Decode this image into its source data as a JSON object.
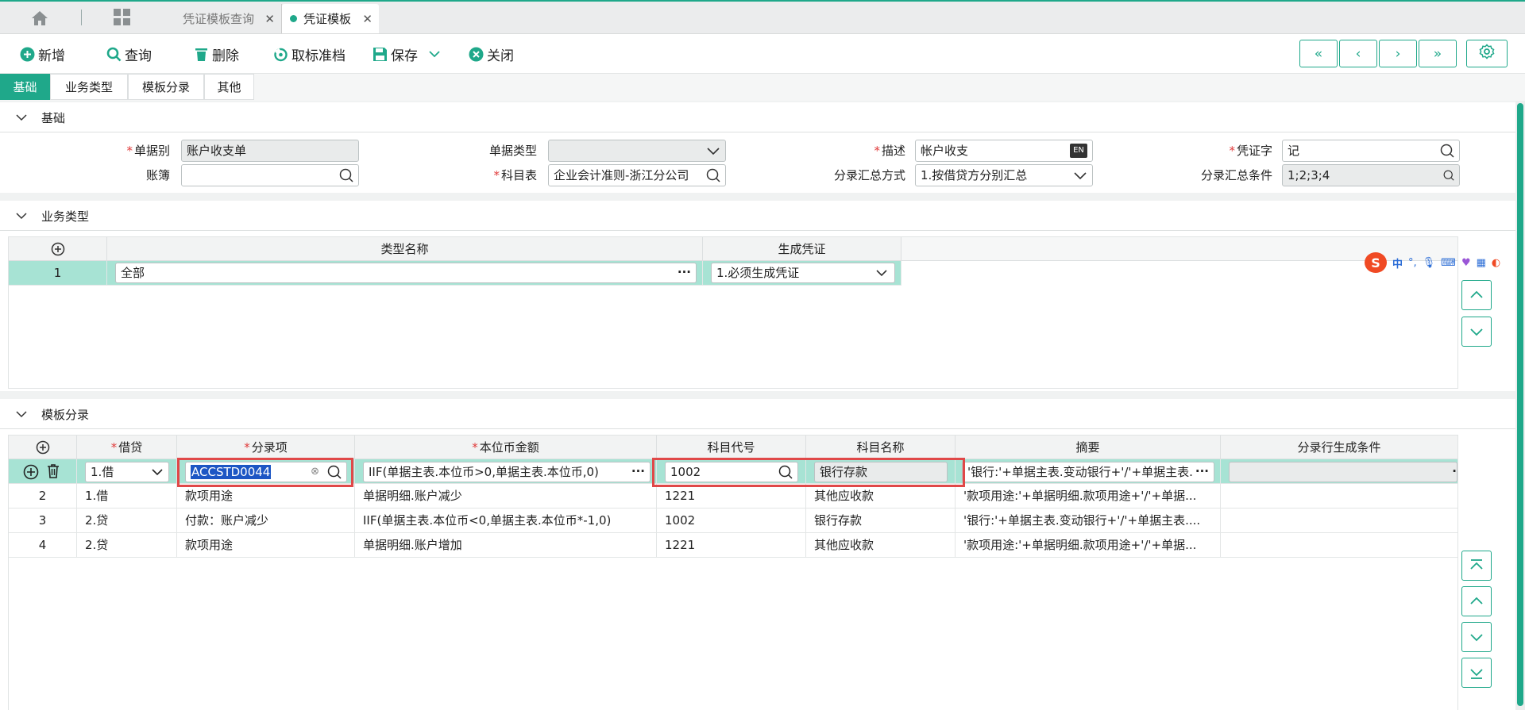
{
  "tabs": [
    {
      "label": "凭证模板查询"
    },
    {
      "label": "凭证模板"
    }
  ],
  "toolbar": {
    "add": "新增",
    "query": "查询",
    "delete": "删除",
    "unarchive": "取标准档",
    "save": "保存",
    "close": "关闭"
  },
  "section_tabs": [
    "基础",
    "业务类型",
    "模板分录",
    "其他"
  ],
  "basic": {
    "title": "基础",
    "doc_type_label": "单据别",
    "doc_type_value": "账户收支单",
    "ledger_label": "账簿",
    "ledger_value": "",
    "bill_type_label": "单据类型",
    "bill_type_value": "",
    "chart_label": "科目表",
    "chart_value": "企业会计准则-浙江分公司",
    "desc_label": "描述",
    "desc_value": "帐户收支",
    "summary_method_label": "分录汇总方式",
    "summary_method_value": "1.按借贷方分别汇总",
    "voucher_word_label": "凭证字",
    "voucher_word_value": "记",
    "summary_cond_label": "分录汇总条件",
    "summary_cond_value": "1;2;3;4"
  },
  "business": {
    "title": "业务类型",
    "headers": [
      "类型名称",
      "生成凭证"
    ],
    "rows": [
      {
        "no": "1",
        "name": "全部",
        "gen": "1.必须生成凭证"
      }
    ]
  },
  "entries": {
    "title": "模板分录",
    "headers": [
      "借贷",
      "分录项",
      "本位币金额",
      "科目代号",
      "科目名称",
      "摘要",
      "分录行生成条件"
    ],
    "rows": [
      {
        "no": "",
        "dc": "1.借",
        "item": "ACCSTD0044",
        "amount": "IIF(单据主表.本位币>0,单据主表.本位币,0)",
        "code": "1002",
        "name": "银行存款",
        "summary": "'银行:'+单据主表.变动银行+'/'+单据主表.",
        "cond": ""
      },
      {
        "no": "2",
        "dc": "1.借",
        "item": "款项用途",
        "amount": "单据明细.账户减少",
        "code": "1221",
        "name": "其他应收款",
        "summary": "'款项用途:'+单据明细.款项用途+'/'+单据...",
        "cond": ""
      },
      {
        "no": "3",
        "dc": "2.贷",
        "item": "付款：账户减少",
        "amount": "IIF(单据主表.本位币<0,单据主表.本位币*-1,0)",
        "code": "1002",
        "name": "银行存款",
        "summary": "'银行:'+单据主表.变动银行+'/'+单据主表....",
        "cond": ""
      },
      {
        "no": "4",
        "dc": "2.贷",
        "item": "款项用途",
        "amount": "单据明细.账户增加",
        "code": "1221",
        "name": "其他应收款",
        "summary": "'款项用途:'+单据明细.款项用途+'/'+单据...",
        "cond": ""
      }
    ]
  },
  "ime": {
    "mode": "中"
  },
  "colors": {
    "accent": "#1fa88a",
    "highlight": "#e04848",
    "selected_row": "#a7e3d4"
  }
}
